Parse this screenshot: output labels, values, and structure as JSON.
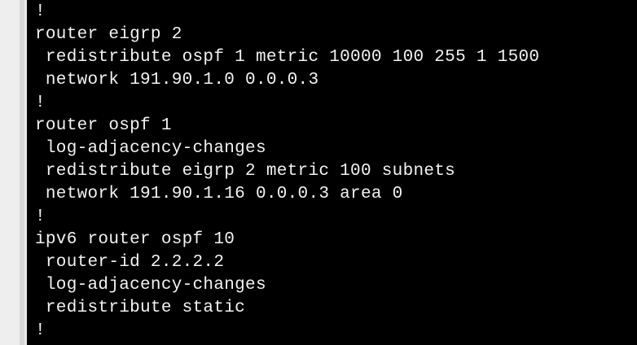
{
  "terminal": {
    "lines": [
      "!",
      "router eigrp 2",
      " redistribute ospf 1 metric 10000 100 255 1 1500",
      " network 191.90.1.0 0.0.0.3",
      "!",
      "router ospf 1",
      " log-adjacency-changes",
      " redistribute eigrp 2 metric 100 subnets",
      " network 191.90.1.16 0.0.0.3 area 0",
      "!",
      "ipv6 router ospf 10",
      " router-id 2.2.2.2",
      " log-adjacency-changes",
      " redistribute static",
      "!"
    ]
  },
  "colors": {
    "background": "#000000",
    "text": "#f2f2f2",
    "gutter": "#eeeeee"
  }
}
